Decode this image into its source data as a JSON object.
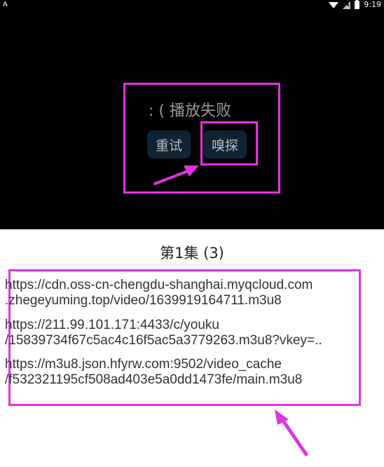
{
  "status_bar": {
    "left_icon": "A",
    "time": "9:19",
    "icons": [
      "wifi-icon",
      "signal-icon",
      "battery-icon"
    ]
  },
  "player": {
    "error_message": ": ( 播放失败",
    "retry_label": "重试",
    "sniff_label": "嗅探"
  },
  "episode": {
    "title": "第1集 (3)"
  },
  "urls": [
    {
      "line1": "https://cdn.oss-cn-chengdu-shanghai.myqcloud.com",
      "line2": ".zhegeyuming.top/video/1639919164711.m3u8"
    },
    {
      "line1": "https://211.99.101.171:4433/c/youku",
      "line2": "/15839734f67c5ac4c16f5ac5a3779263.m3u8?vkey=.."
    },
    {
      "line1": "https://m3u8.json.hfyrw.com:9502/video_cache",
      "line2": "/f532321195cf508ad403e5a0dd1473fe/main.m3u8"
    }
  ],
  "colors": {
    "annotation": "#e133e0",
    "button_bg": "#0e2333",
    "player_bg": "#000000"
  }
}
